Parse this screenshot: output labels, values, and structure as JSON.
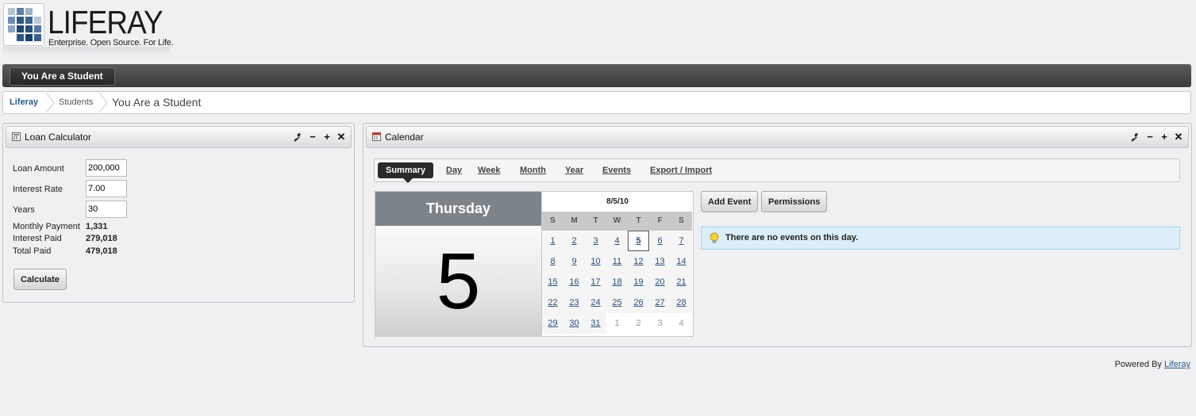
{
  "branding": {
    "logo_word": "LIFERAY",
    "tagline": "Enterprise. Open Source. For Life."
  },
  "navigation": {
    "items": [
      {
        "label": "You Are a Student",
        "selected": true
      }
    ]
  },
  "breadcrumb": {
    "items": [
      "Liferay",
      "Students",
      "You Are a Student"
    ]
  },
  "loan_calculator": {
    "title": "Loan Calculator",
    "fields": [
      {
        "label": "Loan Amount",
        "value": "200,000"
      },
      {
        "label": "Interest Rate",
        "value": "7.00"
      },
      {
        "label": "Years",
        "value": "30"
      }
    ],
    "results": [
      {
        "label": "Monthly Payment",
        "value": "1,331"
      },
      {
        "label": "Interest Paid",
        "value": "279,018"
      },
      {
        "label": "Total Paid",
        "value": "479,018"
      }
    ],
    "button_label": "Calculate"
  },
  "calendar": {
    "title": "Calendar",
    "tabs": [
      "Summary",
      "Day",
      "Week",
      "Month",
      "Year",
      "Events",
      "Export / Import"
    ],
    "selected_tab": "Summary",
    "day_name": "Thursday",
    "day_number": "5",
    "month_header": "8/5/10",
    "weekdays": [
      "S",
      "M",
      "T",
      "W",
      "T",
      "F",
      "S"
    ],
    "weeks": [
      [
        "1",
        "2",
        "3",
        "4",
        "5",
        "6",
        "7"
      ],
      [
        "8",
        "9",
        "10",
        "11",
        "12",
        "13",
        "14"
      ],
      [
        "15",
        "16",
        "17",
        "18",
        "19",
        "20",
        "21"
      ],
      [
        "22",
        "23",
        "24",
        "25",
        "26",
        "27",
        "28"
      ],
      [
        "29",
        "30",
        "31",
        "1",
        "2",
        "3",
        "4"
      ]
    ],
    "today": "5",
    "buttons": {
      "add_event": "Add Event",
      "permissions": "Permissions"
    },
    "notice": "There are no events on this day."
  },
  "footer": {
    "prefix": "Powered By",
    "link": "Liferay"
  },
  "colors": {
    "nav_bar": "#3a3a3c",
    "link": "#2b5b8a",
    "day_header": "#7d8489",
    "notice_bg": "#dbeef9"
  }
}
